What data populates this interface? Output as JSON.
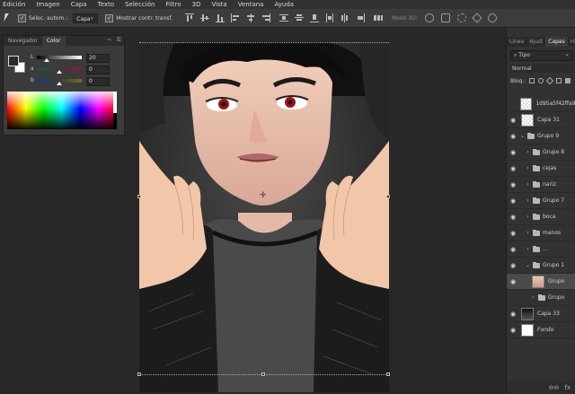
{
  "menu": [
    "Edición",
    "Imagen",
    "Capa",
    "Texto",
    "Selección",
    "Filtro",
    "3D",
    "Vista",
    "Ventana",
    "Ayuda"
  ],
  "options": {
    "autoselect_label": "Selec. autom.:",
    "autoselect_target": "Capa",
    "show_transform_label": "Mostrar contr. transf.",
    "mode3d_label": "Modo 3D:"
  },
  "color_panel": {
    "tabs": [
      "Navegador",
      "Color"
    ],
    "active_tab": "Color",
    "sliders": [
      {
        "label": "L",
        "value": "20"
      },
      {
        "label": "a",
        "value": "0"
      },
      {
        "label": "b",
        "value": "0"
      }
    ]
  },
  "layers_panel": {
    "tabs": [
      "Línea",
      "Ajust",
      "Capas",
      "Hi"
    ],
    "active_tab": "Capas",
    "filter_kind": "Tipo",
    "blend_mode": "Normal",
    "lock_label": "Bloq.:",
    "layers": [
      {
        "name": "1d95a5f42ffa92",
        "type": "image",
        "visible": false,
        "thumb": "check",
        "arrow": ""
      },
      {
        "name": "Capa 31",
        "type": "image",
        "visible": true,
        "thumb": "check",
        "arrow": ""
      },
      {
        "name": "Grupo 9",
        "type": "group",
        "visible": true,
        "arrow": "⌄"
      },
      {
        "name": "Grupo 8",
        "type": "group",
        "visible": true,
        "arrow": "›"
      },
      {
        "name": "cejas",
        "type": "group",
        "visible": true,
        "arrow": "›"
      },
      {
        "name": "nariz",
        "type": "group",
        "visible": true,
        "arrow": "›"
      },
      {
        "name": "Grupo 7",
        "type": "group",
        "visible": true,
        "arrow": "›"
      },
      {
        "name": "boca",
        "type": "group",
        "visible": true,
        "arrow": "›"
      },
      {
        "name": "manos",
        "type": "group",
        "visible": true,
        "arrow": "›"
      },
      {
        "name": "...",
        "type": "group",
        "visible": true,
        "arrow": "›"
      },
      {
        "name": "Grupo 1",
        "type": "group",
        "visible": true,
        "arrow": "⌄"
      },
      {
        "name": "Grupo",
        "type": "image",
        "visible": true,
        "thumb": "face",
        "arrow": "",
        "selected": true
      },
      {
        "name": "Grupo",
        "type": "group",
        "visible": false,
        "arrow": "›"
      },
      {
        "name": "Capa 33",
        "type": "image",
        "visible": true,
        "thumb": "dark",
        "arrow": ""
      },
      {
        "name": "Fondo",
        "type": "image",
        "visible": true,
        "thumb": "white",
        "arrow": "",
        "italic": true
      }
    ],
    "footer_fx": "fx"
  },
  "colors": {
    "menubar": "#323232",
    "panel": "#3b3b3b",
    "canvas_bg": "#282828"
  }
}
